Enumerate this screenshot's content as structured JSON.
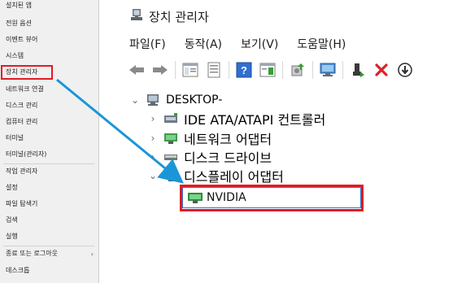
{
  "quick_menu": {
    "items": [
      {
        "label": "설치된 앱"
      },
      {
        "label": "전원 옵션"
      },
      {
        "label": "이벤트 뷰어"
      },
      {
        "label": "시스템"
      },
      {
        "label": "장치 관리자"
      },
      {
        "label": "네트워크 연결"
      },
      {
        "label": "디스크 관리"
      },
      {
        "label": "컴퓨터 관리"
      },
      {
        "label": "터미널"
      },
      {
        "label": "터미널(관리자)"
      },
      {
        "label": "작업 관리자"
      },
      {
        "label": "설정"
      },
      {
        "label": "파일 탐색기"
      },
      {
        "label": "검색"
      },
      {
        "label": "실행"
      },
      {
        "label": "종료 또는 로그아웃"
      },
      {
        "label": "데스크톱"
      }
    ],
    "submenu_arrow": "›",
    "highlight_color": "#e21b23"
  },
  "device_manager": {
    "title": "장치 관리자",
    "menus": [
      "파일(F)",
      "동작(A)",
      "보기(V)",
      "도움말(H)"
    ],
    "toolbar_icons": [
      "back-arrow-icon",
      "forward-arrow-icon",
      "show-hide-console-tree-icon",
      "properties-icon",
      "help-icon",
      "action-pane-icon",
      "update-driver-icon",
      "scan-hardware-icon",
      "enable-device-icon",
      "uninstall-device-icon",
      "disable-device-icon"
    ],
    "tree": {
      "root": "DESKTOP-",
      "children": [
        {
          "label": "IDE ATA/ATAPI 컨트롤러",
          "expanded": false
        },
        {
          "label": "네트워크 어댑터",
          "expanded": false
        },
        {
          "label": "디스크 드라이브",
          "expanded": false
        },
        {
          "label": "디스플레이 어댑터",
          "expanded": true
        }
      ],
      "selected_device": "NVIDIA"
    },
    "accent_color": "#2a7ad5"
  }
}
